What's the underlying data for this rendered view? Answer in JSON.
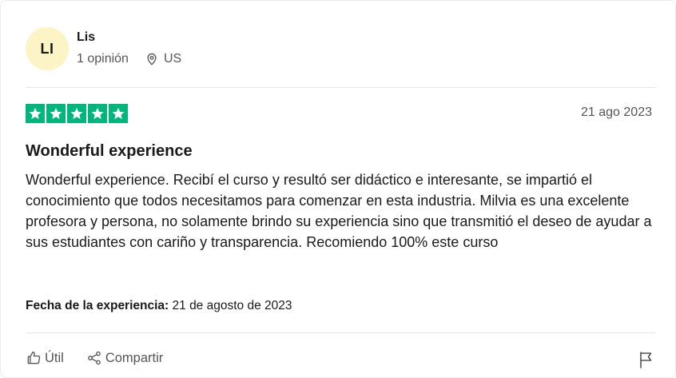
{
  "reviewer": {
    "initials": "LI",
    "name": "Lis",
    "review_count": "1 opinión",
    "country": "US"
  },
  "review": {
    "rating": 5,
    "date": "21 ago 2023",
    "title": "Wonderful experience",
    "body": "Wonderful experience. Recibí el curso y resultó ser didáctico e interesante, se impartió el conocimiento que todos necesitamos para comenzar en esta industria. Milvia es una excelente profesora y persona, no solamente brindo su experiencia sino que transmitió el deseo de ayudar a sus estudiantes con cariño y transparencia. Recomiendo 100% este curso",
    "experience_label": "Fecha de la experiencia:",
    "experience_date": "21 de agosto de 2023"
  },
  "actions": {
    "useful_label": "Útil",
    "share_label": "Compartir"
  },
  "colors": {
    "star_green": "#00b67a",
    "avatar_bg": "#fdf4c5",
    "muted_text": "#555555"
  },
  "icons": [
    "location-pin-icon",
    "star-icon",
    "thumbs-up-icon",
    "share-icon",
    "flag-icon"
  ]
}
